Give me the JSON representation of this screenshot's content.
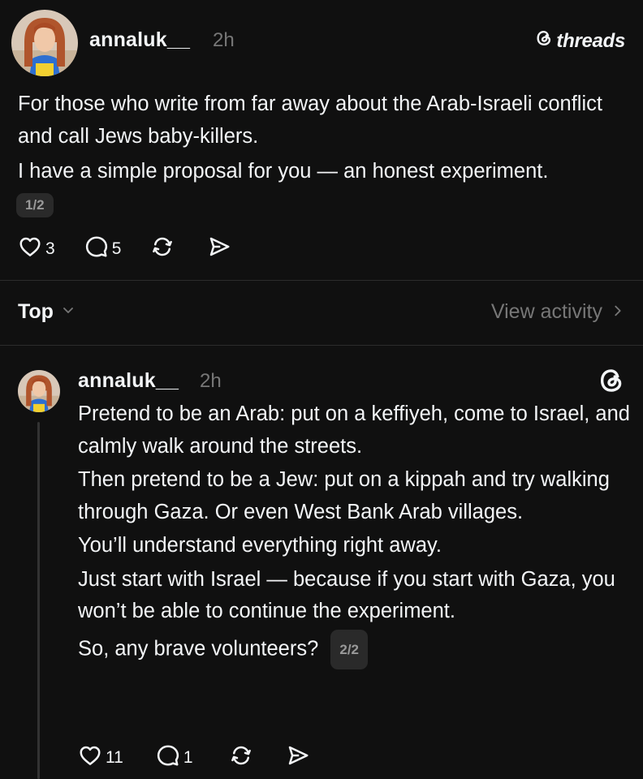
{
  "post": {
    "username": "annaluk__",
    "time": "2h",
    "brand": "threads",
    "lines": [
      "For those who write from far away about the Arab-Israeli conflict and call Jews baby-killers.",
      "I have a simple proposal for you — an honest experiment."
    ],
    "page_indicator": "1/2",
    "likes": "3",
    "replies": "5"
  },
  "replies_header": {
    "sort_label": "Top",
    "view_activity": "View activity"
  },
  "reply": {
    "username": "annaluk__",
    "time": "2h",
    "paragraphs": [
      "Pretend to be an Arab: put on a keffiyeh, come to Israel, and calmly walk around the streets.",
      "Then pretend to be a Jew: put on a kippah and try walking through Gaza. Or even West Bank Arab villages.",
      "You’ll understand everything right away.",
      "Just start with Israel — because if you start with Gaza, you won’t be able to continue the experiment.",
      "So, any brave volunteers?"
    ],
    "page_indicator": "2/2",
    "likes": "11",
    "replies": "1"
  },
  "icons": {
    "like": "heart-icon",
    "reply": "comment-icon",
    "repost": "repost-icon",
    "share": "share-icon",
    "brand": "threads-logo-icon"
  },
  "colors": {
    "background": "#101010",
    "text": "#f3f5f7",
    "muted": "#777777"
  }
}
